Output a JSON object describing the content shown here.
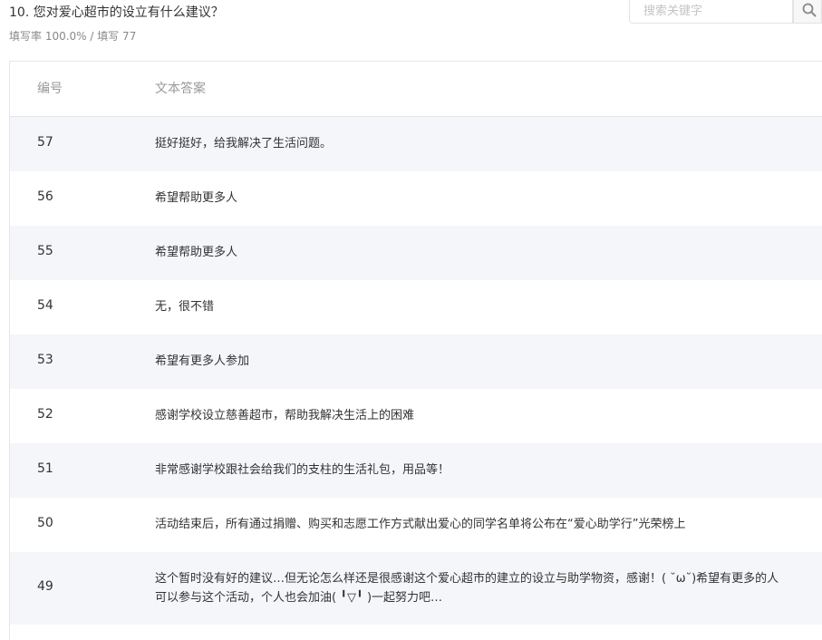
{
  "question": {
    "title": "10. 您对爱心超市的设立有什么建议？",
    "meta": "填写率 100.0% / 填写 77"
  },
  "search": {
    "placeholder": "搜索关键字",
    "icon": "search-icon"
  },
  "table": {
    "columns": [
      "编号",
      "文本答案"
    ],
    "rows": [
      {
        "id": "57",
        "text": "挺好挺好，给我解决了生活问题。"
      },
      {
        "id": "56",
        "text": "希望帮助更多人"
      },
      {
        "id": "55",
        "text": "希望帮助更多人"
      },
      {
        "id": "54",
        "text": "无，很不错"
      },
      {
        "id": "53",
        "text": "希望有更多人参加"
      },
      {
        "id": "52",
        "text": "感谢学校设立慈善超市，帮助我解决生活上的困难"
      },
      {
        "id": "51",
        "text": "非常感谢学校跟社会给我们的支柱的生活礼包，用品等！"
      },
      {
        "id": "50",
        "text": "活动结束后，所有通过捐赠、购买和志愿工作方式献出爱心的同学名单将公布在“爱心助学行”光荣榜上"
      },
      {
        "id": "49",
        "text": "这个暂时没有好的建议…但无论怎么样还是很感谢这个爱心超市的建立的设立与助学物资，感谢！( ˘ω˘)希望有更多的人可以参与这个活动，个人也会加油( ╹▽╹ )一起努力吧…"
      }
    ]
  }
}
